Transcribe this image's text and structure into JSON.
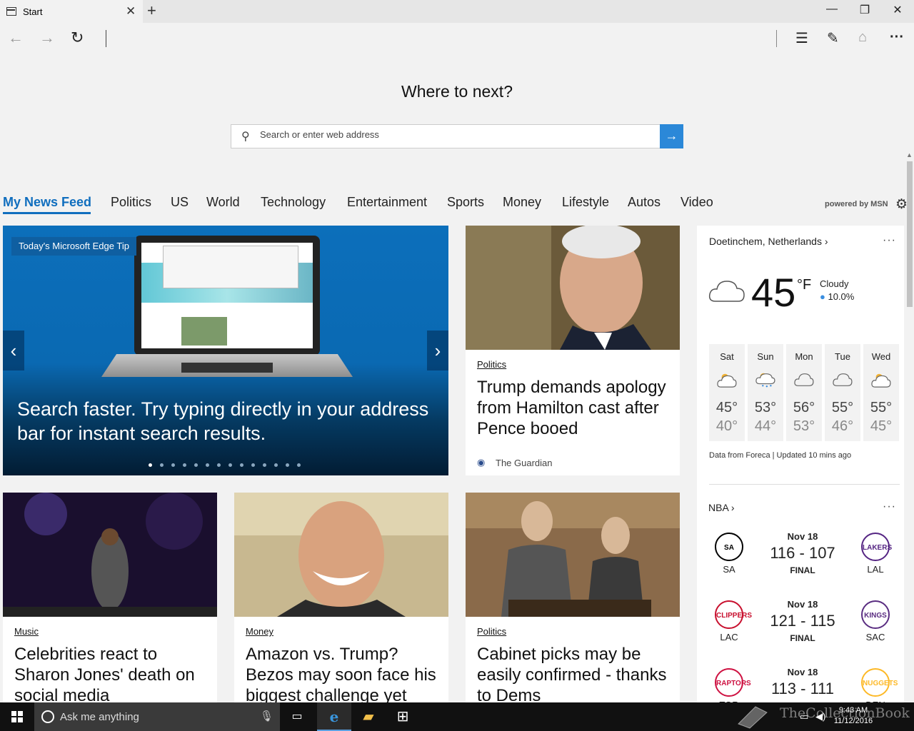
{
  "browser": {
    "tab_title": "Start",
    "tab_close": "✕",
    "new_tab": "+",
    "window_controls": {
      "minimize": "—",
      "restore": "❐",
      "close": "✕"
    },
    "nav": {
      "back": "←",
      "forward": "→",
      "refresh": "↻"
    },
    "toolbar": {
      "hub": "☰",
      "web_note": "✎",
      "share": "⌂",
      "more": "···"
    }
  },
  "start_page": {
    "heading": "Where to next?",
    "search_placeholder": "Search or enter web address",
    "search_go": "→"
  },
  "categories": [
    "My News Feed",
    "Politics",
    "US",
    "World",
    "Technology",
    "Entertainment",
    "Sports",
    "Money",
    "Lifestyle",
    "Autos",
    "Video"
  ],
  "powered_by": "powered by MSN",
  "carousel": {
    "badge": "Today's Microsoft Edge Tip",
    "caption": "Search faster. Try typing directly in your address bar for instant search results.",
    "prev": "‹",
    "next": "›",
    "slide_count": 14,
    "active_slide": 1
  },
  "featured_article": {
    "tag": "Politics",
    "title": "Trump demands apology from Hamilton cast after Pence booed",
    "source": "The Guardian"
  },
  "articles": [
    {
      "tag": "Music",
      "title": "Celebrities react to Sharon Jones' death on social media"
    },
    {
      "tag": "Money",
      "title": "Amazon vs. Trump? Bezos may soon face his biggest challenge yet"
    },
    {
      "tag": "Politics",
      "title": "Cabinet picks may be easily confirmed - thanks to Dems"
    }
  ],
  "weather": {
    "location": "Doetinchem, Netherlands",
    "more": "···",
    "temperature": "45",
    "unit": "°F",
    "condition": "Cloudy",
    "precip": "10.0%",
    "forecast": [
      {
        "day": "Sat",
        "hi": "45°",
        "lo": "40°",
        "icon": "sun-cloud-icon"
      },
      {
        "day": "Sun",
        "hi": "53°",
        "lo": "44°",
        "icon": "rain-sun-icon"
      },
      {
        "day": "Mon",
        "hi": "56°",
        "lo": "53°",
        "icon": "cloud-icon"
      },
      {
        "day": "Tue",
        "hi": "55°",
        "lo": "46°",
        "icon": "cloud-icon"
      },
      {
        "day": "Wed",
        "hi": "55°",
        "lo": "45°",
        "icon": "sun-cloud-icon"
      }
    ],
    "credit": "Data from Foreca | Updated 10 mins ago"
  },
  "nba": {
    "title": "NBA",
    "more": "···",
    "games": [
      {
        "date": "Nov 18",
        "score": "116 - 107",
        "status": "FINAL",
        "home": "SA",
        "away": "LAL",
        "home_color": "#000000",
        "away_color": "#552583",
        "home_logo": "SA",
        "away_logo": "LAKERS"
      },
      {
        "date": "Nov 18",
        "score": "121 - 115",
        "status": "FINAL",
        "home": "LAC",
        "away": "SAC",
        "home_color": "#c8102e",
        "away_color": "#5a2d81",
        "home_logo": "CLIPPERS",
        "away_logo": "KINGS"
      },
      {
        "date": "Nov 18",
        "score": "113 - 111",
        "status": "",
        "home": "TOR",
        "away": "DEN",
        "home_color": "#ce1141",
        "away_color": "#fdb927",
        "home_logo": "RAPTORS",
        "away_logo": "NUGGETS"
      }
    ]
  },
  "taskbar": {
    "cortana_placeholder": "Ask me anything",
    "time": "9:43 AM",
    "date": "11/12/2016"
  },
  "watermark": "TheCollectionBook",
  "colors": {
    "accent": "#106ebe",
    "search_button": "#2b88d8",
    "taskbar": "#111111"
  }
}
